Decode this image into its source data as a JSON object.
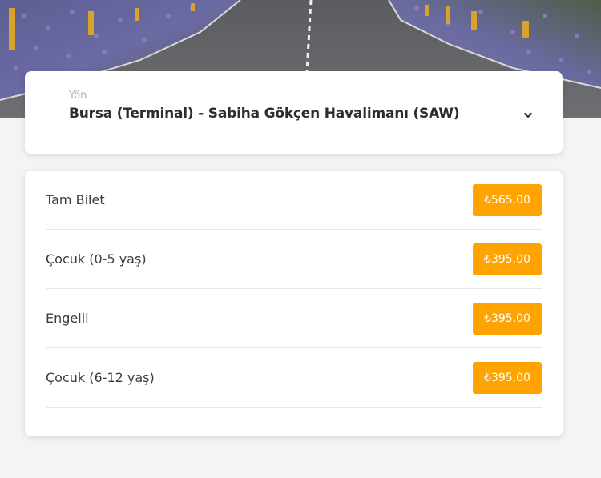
{
  "route": {
    "label": "Yön",
    "value": "Bursa (Terminal) - Sabiha Gökçen Havalimanı (SAW)",
    "icon": "chevron-down-icon"
  },
  "prices": [
    {
      "label": "Tam Bilet",
      "price": "₺565,00"
    },
    {
      "label": "Çocuk (0-5 yaş)",
      "price": "₺395,00"
    },
    {
      "label": "Engelli",
      "price": "₺395,00"
    },
    {
      "label": "Çocuk (6-12 yaş)",
      "price": "₺395,00"
    }
  ],
  "colors": {
    "price_badge": "#ffa300",
    "background": "#f4f4f4",
    "card": "#ffffff"
  }
}
